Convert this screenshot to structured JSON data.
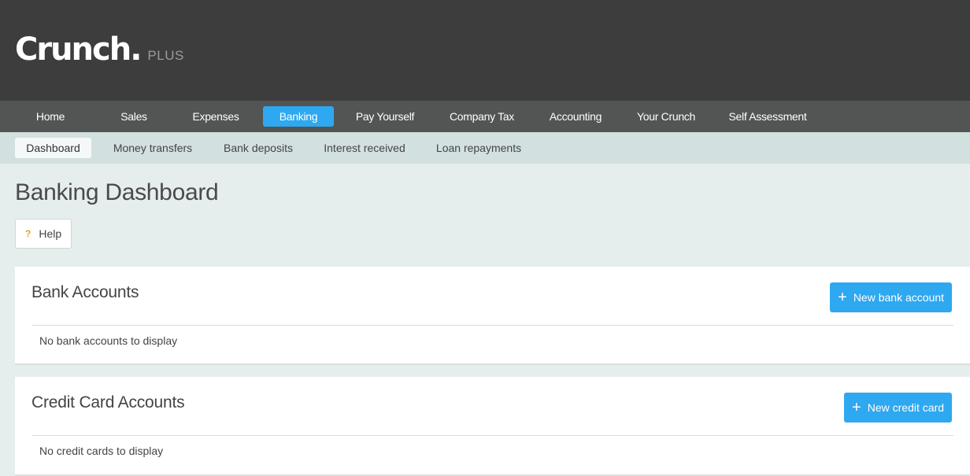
{
  "header": {
    "logo_main": "Crunch.",
    "logo_plus": "PLUS"
  },
  "main_nav": {
    "home": "Home",
    "sales": "Sales",
    "expenses": "Expenses",
    "banking": "Banking",
    "pay_yourself": "Pay Yourself",
    "company_tax": "Company Tax",
    "accounting": "Accounting",
    "your_crunch": "Your Crunch",
    "self_assessment": "Self Assessment",
    "active": "Banking"
  },
  "sub_nav": {
    "dashboard": "Dashboard",
    "money_transfers": "Money transfers",
    "bank_deposits": "Bank deposits",
    "interest_received": "Interest received",
    "loan_repayments": "Loan repayments",
    "active": "Dashboard"
  },
  "page": {
    "title": "Banking Dashboard",
    "help_icon": "?",
    "help_label": "Help"
  },
  "bank_accounts": {
    "title": "Bank Accounts",
    "button_icon": "+",
    "button_label": "New bank account",
    "empty_text": "No bank accounts to display"
  },
  "credit_cards": {
    "title": "Credit Card Accounts",
    "button_icon": "+",
    "button_label": "New credit card",
    "empty_text": "No credit cards to display"
  },
  "colors": {
    "header_bg": "#3c3d3c",
    "nav_bg": "#535454",
    "subnav_bg": "#d3e0e0",
    "page_bg": "#e6eeed",
    "accent": "#2ea8f0",
    "help_icon": "#f0a020"
  }
}
